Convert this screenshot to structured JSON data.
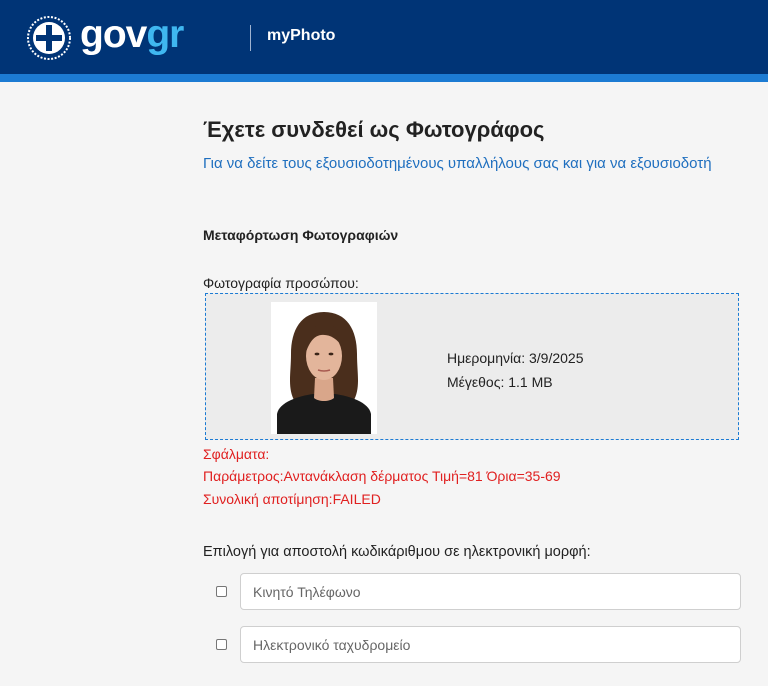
{
  "header": {
    "brand_part1": "gov",
    "brand_part2": "gr",
    "app_name": "myPhoto",
    "logo_icon": "greek-cross-emblem-icon",
    "colors": {
      "bar": "#003476",
      "stripe": "#1c7bd3",
      "accent": "#3fb7f0"
    }
  },
  "main": {
    "title": "Έχετε συνδεθεί ως Φωτογράφος",
    "info_link": "Για να δείτε τους εξουσιοδοτημένους υπαλλήλους σας και για να εξουσιοδοτή",
    "section_title": "Μεταφόρτωση Φωτογραφιών",
    "photo_label": "Φωτογραφία προσώπου:",
    "photo": {
      "date": "Ημερομηνία: 3/9/2025",
      "size": "Μέγεθος: 1.1 MB"
    },
    "errors": {
      "heading": "Σφάλματα:",
      "parameter": "Παράμετρος:Αντανάκλαση δέρματος Τιμή=81 Όρια=35-69",
      "overall": "Συνολική αποτίμηση:FAILED",
      "color": "#e02020"
    },
    "send_label": "Επιλογή για αποστολή κωδικάριθμου σε ηλεκτρονική μορφή:",
    "phone_placeholder": "Κινητό Τηλέφωνο",
    "email_placeholder": "Ηλεκτρονικό ταχυδρομείο"
  }
}
